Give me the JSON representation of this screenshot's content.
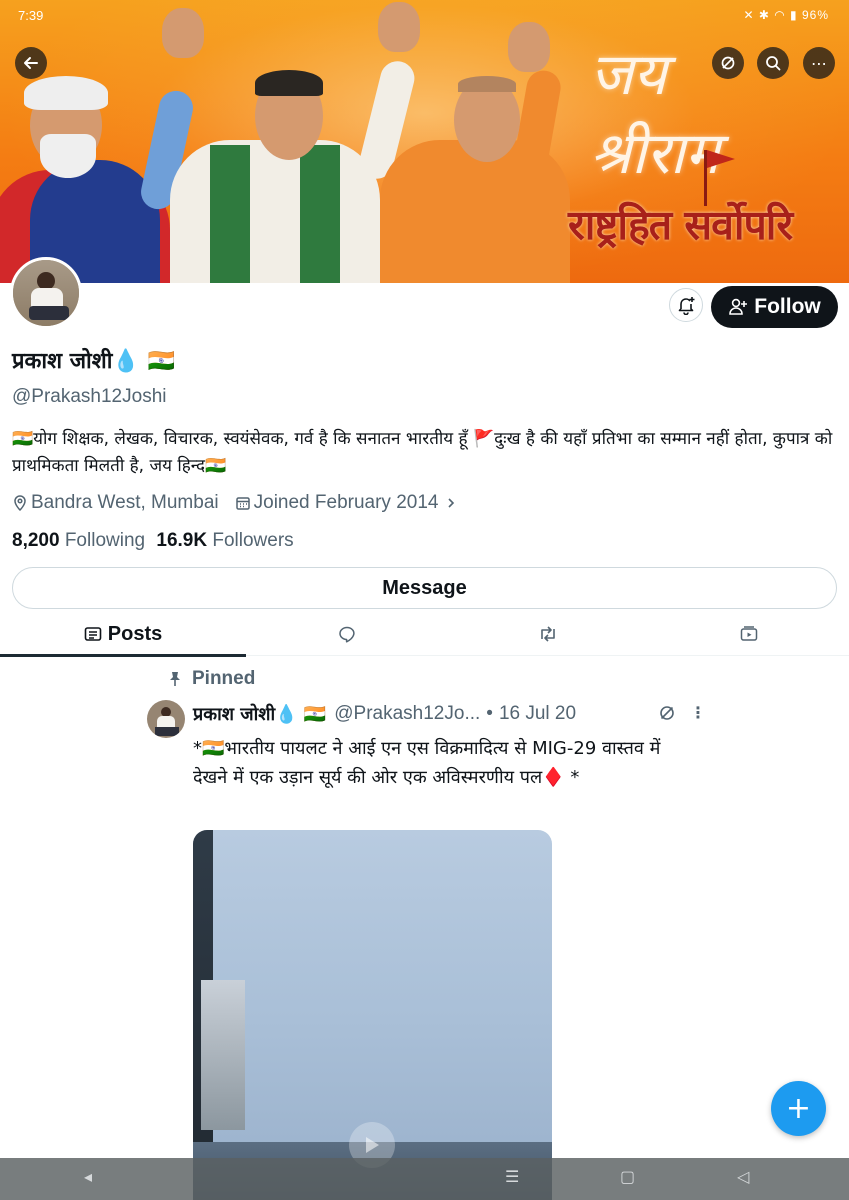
{
  "status_bar": {
    "time": "7:39",
    "battery": "96%"
  },
  "banner": {
    "script_text": "जय श्रीराम",
    "slogan": "राष्ट्रहित सर्वोपरि"
  },
  "top_actions": {
    "back": "←",
    "search": "⌕",
    "more": "⋯"
  },
  "profile": {
    "name": "प्रकाश जोशी💧 🇮🇳",
    "handle": "@Prakash12Joshi",
    "bio": "🇮🇳योग शिक्षक, लेखक, विचारक, स्वयंसेवक, गर्व है कि सनातन भारतीय हूँ 🚩दुःख है की यहाँ प्रतिभा का सम्मान नहीं होता, कुपात्र को प्राथमिकता मिलती है, जय हिन्द🇮🇳",
    "location": "Bandra West, Mumbai",
    "joined": "Joined February 2014",
    "following_count": "8,200",
    "following_label": "Following",
    "followers_count": "16.9K",
    "followers_label": "Followers"
  },
  "buttons": {
    "follow": "Follow",
    "message": "Message"
  },
  "tabs": {
    "posts": "Posts"
  },
  "pinned_post": {
    "pinned_label": "Pinned",
    "author_name": "प्रकाश जोशी💧 🇮🇳",
    "author_handle": "@Prakash12Jo...",
    "separator": "•",
    "date": "16 Jul 20",
    "more": "⋮",
    "text": "*🇮🇳भारतीय पायलट ने आई एन एस विक्रमादित्य से MIG-29 वास्तव में देखने में एक उड़ान सूर्य की ओर एक अविस्मरणीय पल♦️ *"
  },
  "fab": {
    "label": "+"
  },
  "system_nav": {
    "back": "◁",
    "home": "▢",
    "recents": "☰",
    "left": "◂"
  },
  "colors": {
    "accent": "#1d9bf0",
    "text": "#0f1419",
    "muted": "#536471",
    "banner": "#f47d13"
  },
  "icons": [
    "back-arrow-icon",
    "grok-icon",
    "search-icon",
    "more-icon",
    "bell-plus-icon",
    "person-plus-icon",
    "location-pin-icon",
    "calendar-icon",
    "chevron-right-icon",
    "posts-icon",
    "reply-icon",
    "repost-icon",
    "media-icon",
    "pin-icon",
    "play-icon"
  ]
}
